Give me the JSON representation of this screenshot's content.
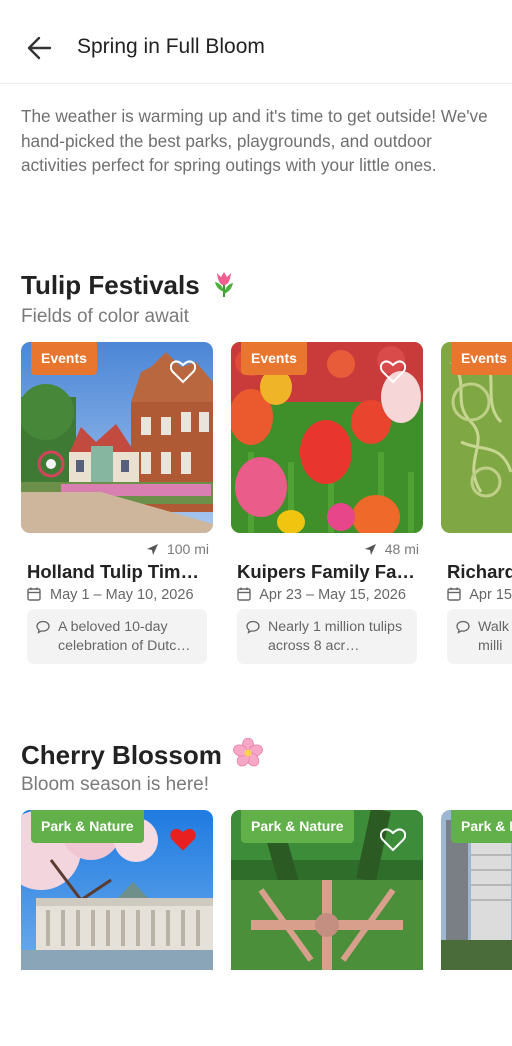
{
  "header": {
    "title": "Spring in Full Bloom",
    "back_icon": "arrow-left-icon"
  },
  "intro": "The weather is warming up and it's time to get outside! We've hand-picked the best parks, playgrounds, and outdoor activities perfect for spring outings with your little ones.",
  "sections": [
    {
      "title": "Tulip Festivals",
      "emoji": "tulip-emoji",
      "subtitle": "Fields of color await",
      "cards": [
        {
          "tag": "Events",
          "distance": "100 mi",
          "name": "Holland Tulip Tim…",
          "dates": "May 1 – May 10, 2026",
          "description": "A beloved 10-day celebration of Dutc…",
          "favorited": false
        },
        {
          "tag": "Events",
          "distance": "48 mi",
          "name": "Kuipers Family Fa…",
          "dates": "Apr 23 – May 15, 2026",
          "description": "Nearly 1 million tulips across 8 acr…",
          "favorited": false
        },
        {
          "tag": "Events",
          "distance": "",
          "name": "Richard",
          "dates": "Apr 15",
          "description": "Walk milli",
          "favorited": false
        }
      ]
    },
    {
      "title": "Cherry Blossom",
      "emoji": "cherry-blossom-emoji",
      "subtitle": "Bloom season is here!",
      "cards": [
        {
          "tag": "Park & Nature",
          "favorited": true
        },
        {
          "tag": "Park & Nature",
          "favorited": false
        },
        {
          "tag": "Park & Nature",
          "favorited": false
        }
      ]
    }
  ],
  "colors": {
    "events_tag": "#e8762f",
    "park_tag": "#62b04a",
    "heart_active": "#e8201f"
  }
}
